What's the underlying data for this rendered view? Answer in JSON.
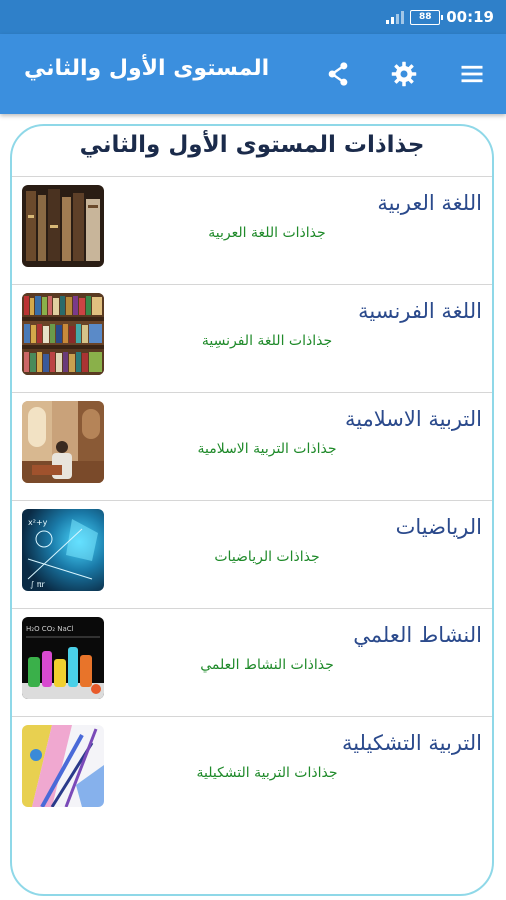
{
  "status_bar": {
    "battery": "88",
    "time": "00:19"
  },
  "app_bar": {
    "title": "المستوى الأول والثاني"
  },
  "card": {
    "title": "جذاذات المستوى الأول والثاني",
    "items": [
      {
        "title": "اللغة العربية",
        "subtitle": "جذاذات اللغة العربية"
      },
      {
        "title": "اللغة الفرنسية",
        "subtitle": "جذاذات اللغة الفرنسِية"
      },
      {
        "title": "التربية الاسلامية",
        "subtitle": "جذاذات التربية الاسلامية"
      },
      {
        "title": "الرياضيات",
        "subtitle": "جذاذات الرياضيات"
      },
      {
        "title": "النشاط العلمي",
        "subtitle": "جذاذات النشاط العلمي"
      },
      {
        "title": "التربية التشكيلية",
        "subtitle": "جذاذات التربية التشكيلية"
      }
    ]
  },
  "colors": {
    "app_bar": "#3b8fde",
    "status_bar": "#2f80c9",
    "item_title": "#2b4a8c",
    "item_subtitle": "#1f8a2a",
    "card_border": "#8fd8e8"
  },
  "icons": [
    "menu-icon",
    "settings-gear-icon",
    "share-icon"
  ]
}
